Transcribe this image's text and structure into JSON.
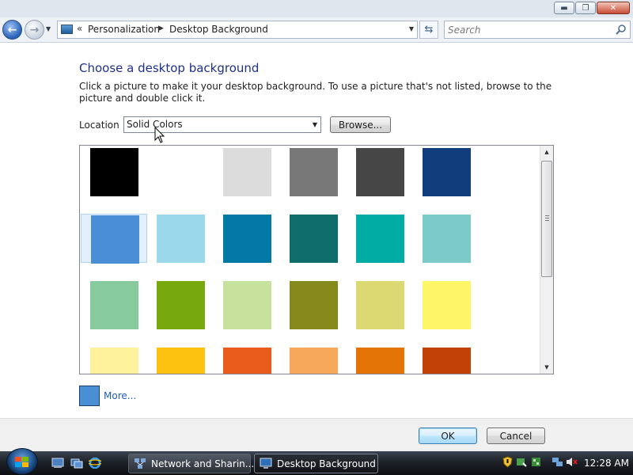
{
  "window": {
    "buttons": {
      "minimize": "▬",
      "maximize": "❐",
      "close": "✕"
    }
  },
  "nav": {
    "back_icon": "back-arrow-icon",
    "forward_icon": "forward-arrow-icon",
    "breadcrumb": [
      "Personalization",
      "Desktop Background"
    ],
    "search_placeholder": "Search"
  },
  "main": {
    "title": "Choose a desktop background",
    "intro": "Click a picture to make it your desktop background. To use a picture that's not listed, browse to the picture and double click it.",
    "location_label": "Location",
    "location_value": "Solid Colors",
    "browse_label": "Browse...",
    "more_label": "More...",
    "more_color": "#4a8fd5",
    "selected_swatch": "#4a8fd5"
  },
  "swatches": [
    [
      "#000000",
      "#ffffff",
      "#dcdcdc",
      "#787878",
      "#464646",
      "#113d7d"
    ],
    [
      "#4a8fd5",
      "#9cd8eb",
      "#0379a6",
      "#0f6d6c",
      "#00aca3",
      "#7dcbc8"
    ],
    [
      "#86ca9d",
      "#77a80e",
      "#c6e29d",
      "#868a1d",
      "#dcd973",
      "#fef567"
    ],
    [
      "#fef39c",
      "#fdc210",
      "#e95c1b",
      "#f8a85a",
      "#e47405",
      "#c24106"
    ]
  ],
  "footer": {
    "ok_label": "OK",
    "cancel_label": "Cancel"
  },
  "taskbar": {
    "tasks": [
      {
        "label": "Network and Sharin...",
        "active": false
      },
      {
        "label": "Desktop Background",
        "active": true
      }
    ],
    "clock": "12:28 AM"
  }
}
